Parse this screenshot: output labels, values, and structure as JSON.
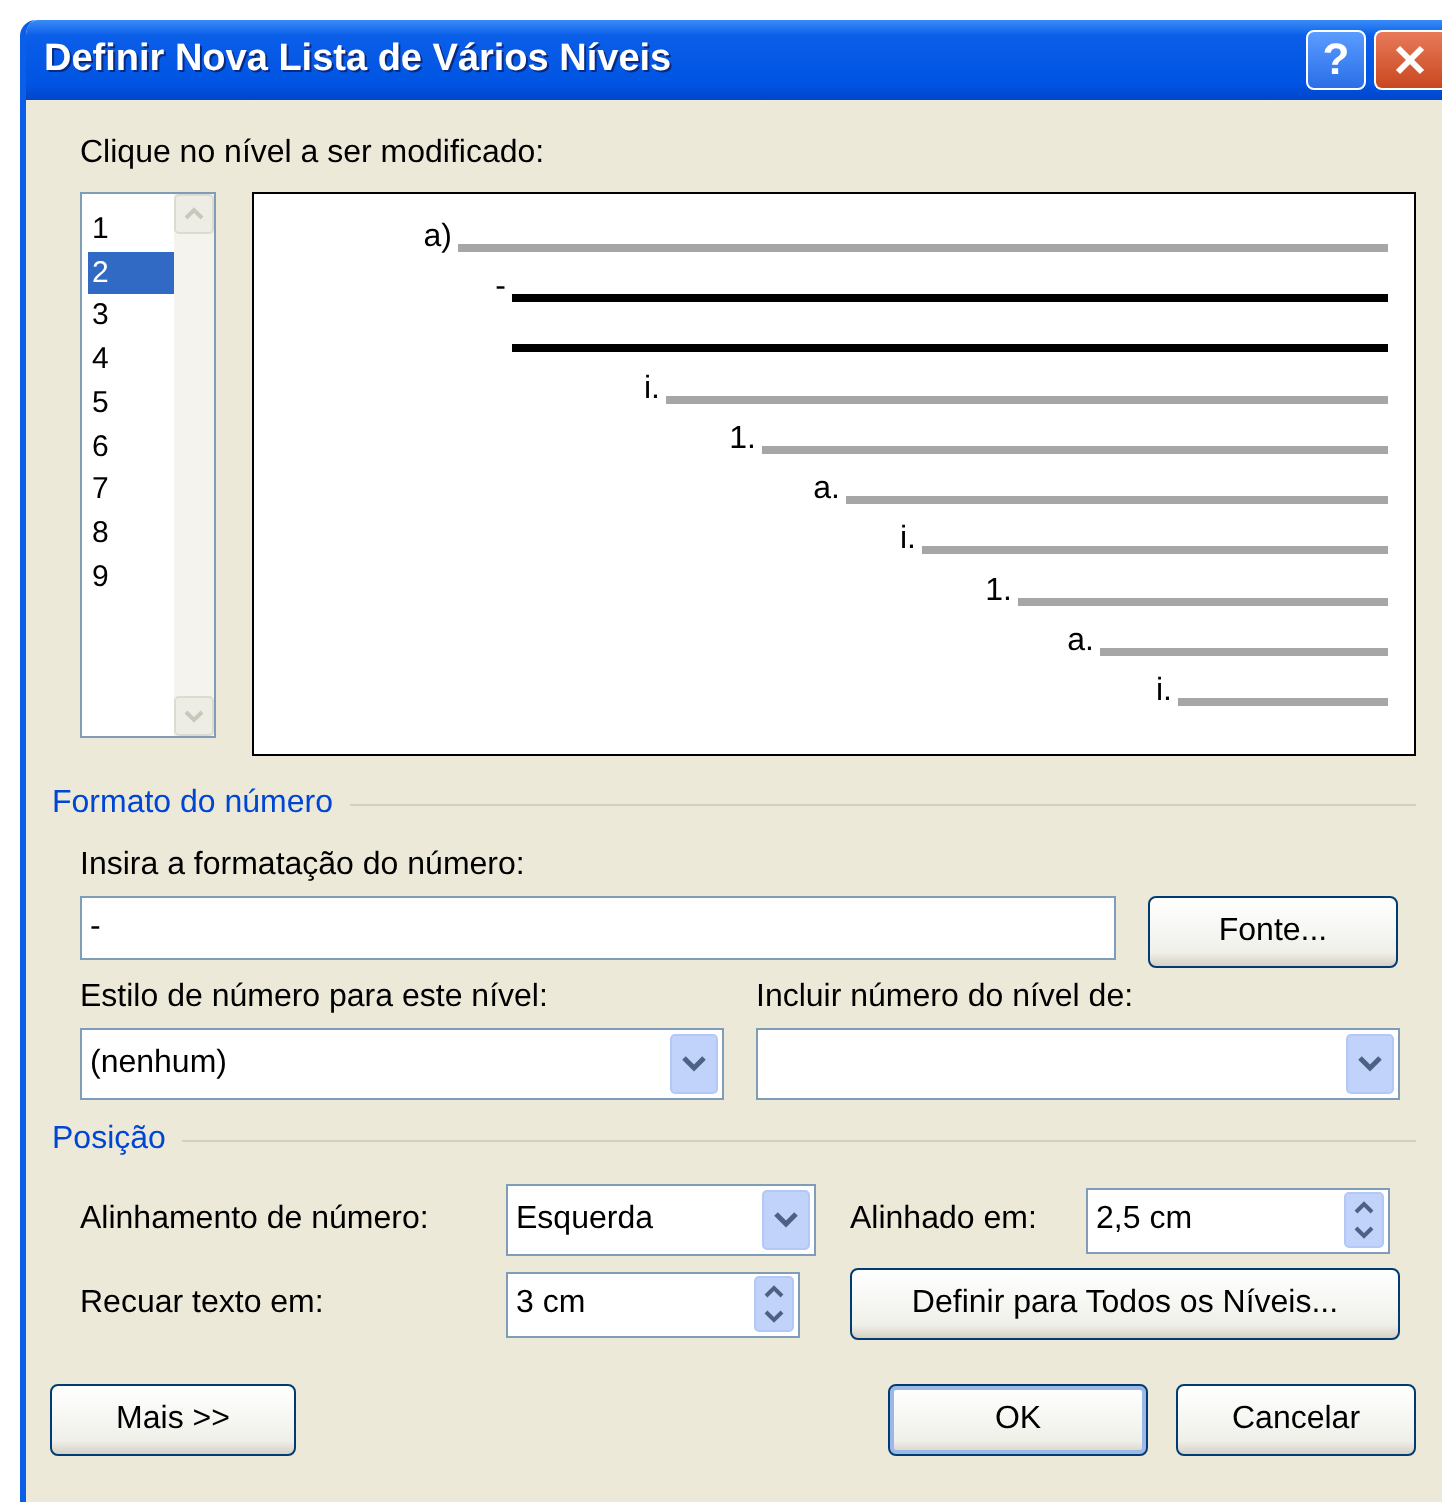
{
  "window": {
    "title": "Definir Nova Lista de Vários Níveis",
    "buttons": [
      {
        "kind": "help",
        "label": "?"
      },
      {
        "kind": "close"
      }
    ]
  },
  "level_picker": {
    "label": "Clique no nível a ser modificado:",
    "items": [
      {
        "label": "1",
        "selected": false
      },
      {
        "label": "2",
        "selected": true
      },
      {
        "label": "3",
        "selected": false
      },
      {
        "label": "4",
        "selected": false
      },
      {
        "label": "5",
        "selected": false
      },
      {
        "label": "6",
        "selected": false
      },
      {
        "label": "7",
        "selected": false
      },
      {
        "label": "8",
        "selected": false
      },
      {
        "label": "9",
        "selected": false
      }
    ]
  },
  "preview": {
    "rows": [
      {
        "label": "a)",
        "highlighted": false
      },
      {
        "label": "-",
        "highlighted": true
      },
      {
        "highlighted": true
      },
      {
        "label": "i.",
        "highlighted": false
      },
      {
        "label": "1.",
        "highlighted": false
      },
      {
        "label": "a.",
        "highlighted": false
      },
      {
        "label": "i.",
        "highlighted": false
      },
      {
        "label": "1.",
        "highlighted": false
      },
      {
        "label": "a.",
        "highlighted": false
      },
      {
        "label": "i.",
        "highlighted": false
      }
    ]
  },
  "number_format": {
    "heading": "Formato do número",
    "format_label": "Insira a formatação do número:",
    "format_value": "-",
    "font_button": "Fonte...",
    "style_label": "Estilo de número para este nível:",
    "style_value": "(nenhum)",
    "include_label": "Incluir número do nível de:"
  },
  "position": {
    "heading": "Posição",
    "alignment_label": "Alinhamento de número:",
    "alignment_value": "Esquerda",
    "aligned_at_label": "Alinhado em:",
    "aligned_at_value": "2,5 cm",
    "indent_label": "Recuar texto em:",
    "indent_value": "3 cm",
    "set_all_button": "Definir para Todos os Níveis..."
  },
  "buttons": [
    {
      "label": "Mais >>",
      "default": false
    },
    {
      "label": "OK",
      "default": true
    },
    {
      "label": "Cancelar",
      "default": false
    }
  ]
}
